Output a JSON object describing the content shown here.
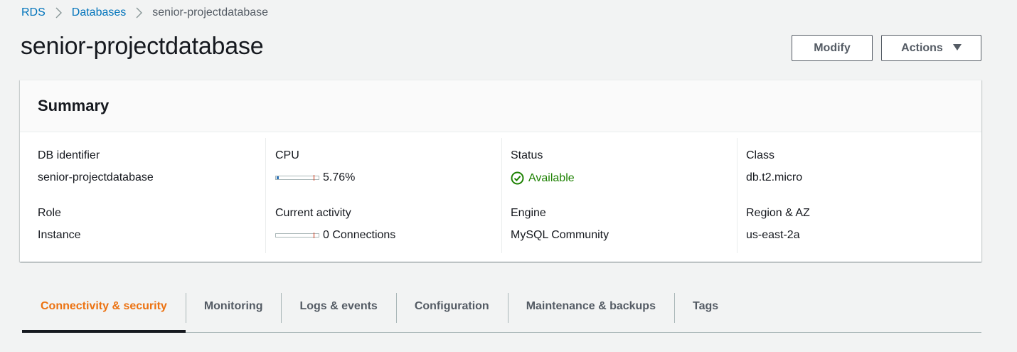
{
  "breadcrumb": {
    "items": [
      "RDS",
      "Databases"
    ],
    "current": "senior-projectdatabase"
  },
  "page": {
    "title": "senior-projectdatabase"
  },
  "header_actions": {
    "modify_label": "Modify",
    "actions_label": "Actions"
  },
  "summary": {
    "title": "Summary",
    "db_identifier_label": "DB identifier",
    "db_identifier_value": "senior-projectdatabase",
    "role_label": "Role",
    "role_value": "Instance",
    "cpu_label": "CPU",
    "cpu_value": "5.76%",
    "cpu_fraction": 0.0576,
    "activity_label": "Current activity",
    "activity_value": "0 Connections",
    "activity_fraction": 0,
    "status_label": "Status",
    "status_value": "Available",
    "engine_label": "Engine",
    "engine_value": "MySQL Community",
    "class_label": "Class",
    "class_value": "db.t2.micro",
    "region_label": "Region & AZ",
    "region_value": "us-east-2a"
  },
  "tabs": [
    {
      "label": "Connectivity & security",
      "active": true
    },
    {
      "label": "Monitoring",
      "active": false
    },
    {
      "label": "Logs & events",
      "active": false
    },
    {
      "label": "Configuration",
      "active": false
    },
    {
      "label": "Maintenance & backups",
      "active": false
    },
    {
      "label": "Tags",
      "active": false
    }
  ],
  "colors": {
    "link": "#0073bb",
    "active_tab": "#ec7211",
    "status_ok": "#1d8102",
    "meter_fill": "#2e73b8",
    "meter_threshold": "#d13212"
  },
  "icons": {
    "breadcrumb_separator": "chevron-right-icon",
    "actions_caret": "caret-down-icon",
    "status": "check-circle-icon"
  }
}
